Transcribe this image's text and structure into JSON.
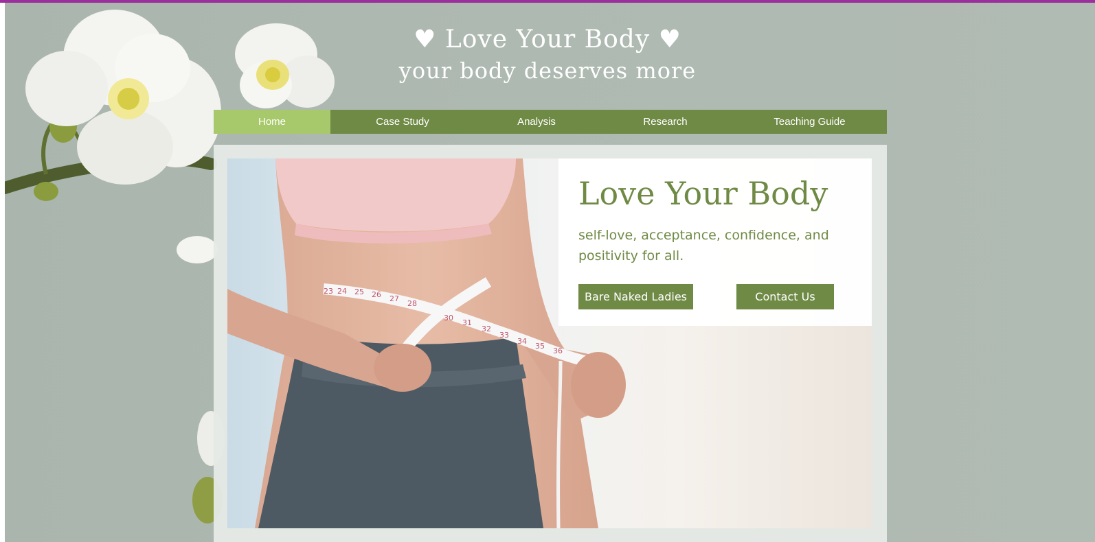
{
  "header": {
    "title": "♥ Love Your Body ♥",
    "subtitle": "your body deserves more"
  },
  "nav": {
    "items": [
      {
        "label": "Home",
        "active": true
      },
      {
        "label": "Case Study",
        "active": false
      },
      {
        "label": "Analysis",
        "active": false
      },
      {
        "label": "Research",
        "active": false
      },
      {
        "label": "Teaching Guide",
        "active": false
      }
    ]
  },
  "hero": {
    "title": "Love Your Body",
    "tagline": "self-love, acceptance, confidence, and positivity for all.",
    "buttons": {
      "primary": "Bare Naked Ladies",
      "secondary": "Contact Us"
    },
    "tape_numbers": [
      "23",
      "24",
      "25",
      "26",
      "27",
      "28",
      "30",
      "31",
      "32",
      "33",
      "34",
      "35",
      "36"
    ]
  },
  "colors": {
    "accent_top_bar": "#9b2f9c",
    "nav_green": "#6f8a45",
    "nav_active": "#a7c96b",
    "text_green": "#6f8a45",
    "background": "#aeb9b1"
  },
  "icons": {
    "heart": "heart-icon",
    "orchid": "orchid-flower-icon"
  }
}
